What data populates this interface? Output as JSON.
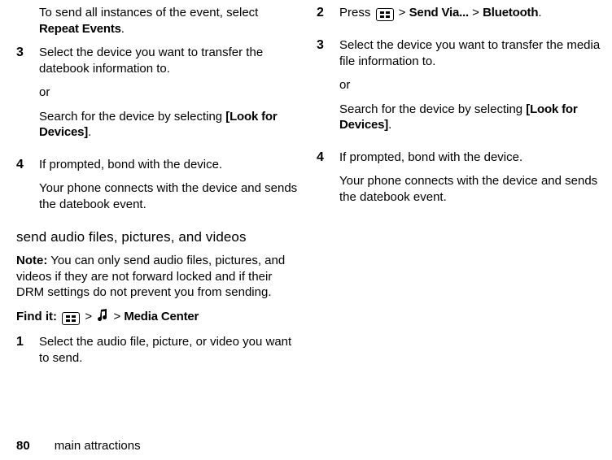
{
  "left": {
    "cont1_a": "To send all instances of the event, select ",
    "cont1_b": "Repeat Events",
    "cont1_c": ".",
    "step3_num": "3",
    "step3_text": "Select the device you want to transfer the datebook information to.",
    "step3_or": "or",
    "step3_search_a": "Search for the device by selecting ",
    "step3_search_b": "[Look for Devices]",
    "step3_search_c": ".",
    "step4_num": "4",
    "step4_text": "If prompted, bond with the device.",
    "step4_result": "Your phone connects with the device and sends the datebook event.",
    "heading": "send audio files, pictures, and videos",
    "note_label": "Note:",
    "note_text": " You can only send audio files, pictures, and videos if they are not forward locked and if their DRM settings do not prevent you from sending.",
    "findit_label": "Find it:",
    "findit_gt1": " > ",
    "findit_gt2": " > ",
    "findit_dest": "Media Center",
    "step1_num": "1",
    "step1_text": "Select the audio file, picture, or video you want to send."
  },
  "right": {
    "step2_num": "2",
    "step2_a": "Press ",
    "step2_gt1": " > ",
    "step2_b": "Send Via...",
    "step2_gt2": " > ",
    "step2_c": "Bluetooth",
    "step2_d": ".",
    "step3_num": "3",
    "step3_text": "Select the device you want to transfer the media file information to.",
    "step3_or": "or",
    "step3_search_a": "Search for the device by selecting ",
    "step3_search_b": "[Look for Devices]",
    "step3_search_c": ".",
    "step4_num": "4",
    "step4_text": "If prompted, bond with the device.",
    "step4_result": "Your phone connects with the device and sends the datebook event."
  },
  "footer": {
    "page": "80",
    "section": "main attractions"
  }
}
